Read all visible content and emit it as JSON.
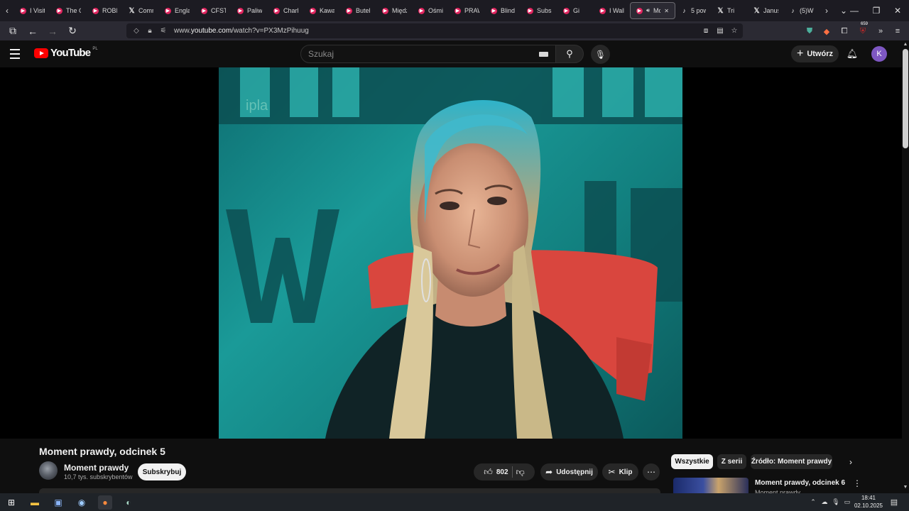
{
  "browser": {
    "tabs": [
      {
        "label": "I Visit",
        "icon": "youtube-icon"
      },
      {
        "label": "The G",
        "icon": "youtube-icon"
      },
      {
        "label": "ROBIN",
        "icon": "youtube-icon"
      },
      {
        "label": "Comm",
        "icon": "x-icon"
      },
      {
        "label": "Englai",
        "icon": "youtube-icon"
      },
      {
        "label": "CFSTV",
        "icon": "youtube-icon"
      },
      {
        "label": "Paliw",
        "icon": "youtube-icon"
      },
      {
        "label": "Charli",
        "icon": "youtube-icon"
      },
      {
        "label": "Kawal",
        "icon": "youtube-icon"
      },
      {
        "label": "Butelk",
        "icon": "youtube-icon"
      },
      {
        "label": "Międz",
        "icon": "youtube-icon"
      },
      {
        "label": "Ośmie",
        "icon": "youtube-icon"
      },
      {
        "label": "PRAW",
        "icon": "youtube-icon"
      },
      {
        "label": "Blind",
        "icon": "youtube-icon"
      },
      {
        "label": "Subsk",
        "icon": "youtube-icon"
      },
      {
        "label": "Gi",
        "icon": "youtube-icon"
      },
      {
        "label": "I Walk",
        "icon": "youtube-icon"
      },
      {
        "label": "Mo",
        "icon": "youtube-icon",
        "active": true
      },
      {
        "label": "5 pow",
        "icon": "tiktok-icon"
      },
      {
        "label": "Tri",
        "icon": "x-icon"
      },
      {
        "label": "Janus",
        "icon": "x-icon"
      },
      {
        "label": "(5)W",
        "icon": "tiktok-icon"
      }
    ],
    "url_prefix": "www.",
    "url_host": "youtube.com",
    "url_path": "/watch?v=PX3MzPihuug",
    "extension_badge": "659"
  },
  "youtube": {
    "logo_text": "YouTube",
    "country_code": "PL",
    "search_placeholder": "Szukaj",
    "create_label": "Utwórz",
    "avatar_letter": "K"
  },
  "video": {
    "title": "Moment prawdy, odcinek 5",
    "channel_name": "Moment prawdy",
    "subscribers": "10,7 tys. subskrybentów",
    "subscribe_label": "Subskrybuj",
    "likes": "802",
    "share_label": "Udostępnij",
    "clip_label": "Klip",
    "watermark": "ipla"
  },
  "sidebar": {
    "chips": [
      {
        "label": "Wszystkie",
        "selected": true
      },
      {
        "label": "Z serii",
        "selected": false
      },
      {
        "label": "Źródło: Moment prawdy",
        "selected": false
      }
    ],
    "recommendation": {
      "title": "Moment prawdy, odcinek 6",
      "channel": "Moment prawdy"
    }
  },
  "taskbar": {
    "time": "18:41",
    "date": "02.10.2025"
  },
  "colors": {
    "youtube_red": "#ff0000",
    "background": "#0f0f0f",
    "avatar_purple": "#7e57c2"
  }
}
